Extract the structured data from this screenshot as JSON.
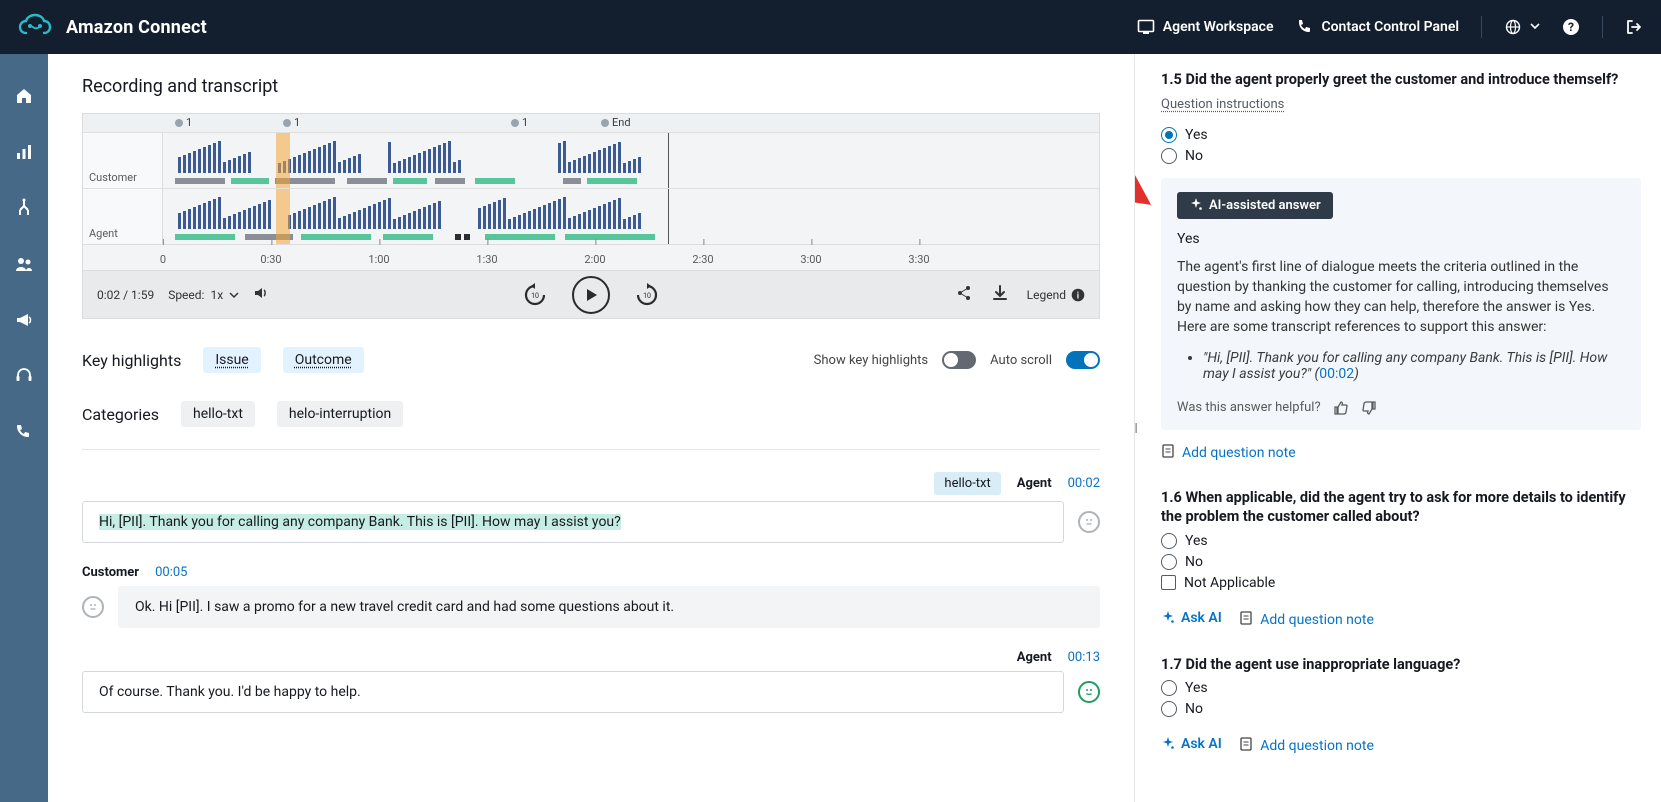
{
  "brand": "Amazon Connect",
  "header": {
    "agent_ws": "Agent Workspace",
    "ccp": "Contact Control Panel"
  },
  "recording": {
    "section_title": "Recording and transcript",
    "lanes": {
      "customer": "Customer",
      "agent": "Agent"
    },
    "flags": [
      "1",
      "1",
      "1"
    ],
    "end_label": "End",
    "ticks": [
      "0",
      "0:30",
      "1:00",
      "1:30",
      "2:00",
      "2:30",
      "3:00",
      "3:30"
    ],
    "time": "0:02 / 1:59",
    "speed_label": "Speed:",
    "speed_value": "1x",
    "legend": "Legend"
  },
  "highlights": {
    "title": "Key highlights",
    "issue": "Issue",
    "outcome": "Outcome",
    "cats_label": "Categories",
    "cats": [
      "hello-txt",
      "helo-interruption"
    ],
    "show_kh": "Show key highlights",
    "auto_scroll": "Auto scroll"
  },
  "transcript": [
    {
      "speaker": "Agent",
      "time": "00:02",
      "cat": "hello-txt",
      "sentiment": "neutral",
      "align": "right",
      "text": "Hi, [PII]. Thank you for calling any company Bank. This is [PII]. How may I assist you?",
      "highlighted": true
    },
    {
      "speaker": "Customer",
      "time": "00:05",
      "sentiment": "neutral",
      "align": "left",
      "text": "Ok. Hi [PII]. I saw a promo for a new travel credit card and had some questions about it."
    },
    {
      "speaker": "Agent",
      "time": "00:13",
      "sentiment": "pos",
      "align": "right",
      "text": "Of course. Thank you. I'd be happy to help."
    }
  ],
  "eval": {
    "q15": {
      "num": "1.5",
      "title": "Did the agent properly greet the customer and introduce themself?",
      "instructions": "Question instructions",
      "options": [
        "Yes",
        "No"
      ],
      "selected": "Yes",
      "ai_badge": "AI-assisted answer",
      "ai_answer": "Yes",
      "ai_explanation": "The agent's first line of dialogue meets the criteria outlined in the question by thanking the customer for calling, introducing themselves by name and asking how they can help, therefore the answer is Yes. Here are some transcript references to support this answer:",
      "ai_quote": "\"Hi, [PII]. Thank you for calling any company Bank. This is [PII]. How may I assist you?\"",
      "ai_quote_time": "00:02",
      "feedback": "Was this answer helpful?",
      "note": "Add question note"
    },
    "q16": {
      "num": "1.6",
      "title": "When applicable, did the agent try to ask for more details to identify the problem the customer called about?",
      "options": [
        "Yes",
        "No",
        "Not Applicable"
      ],
      "askai": "Ask AI",
      "note": "Add question note"
    },
    "q17": {
      "num": "1.7",
      "title": "Did the agent use inappropriate language?",
      "options": [
        "Yes",
        "No"
      ],
      "askai": "Ask AI",
      "note": "Add question note"
    }
  }
}
